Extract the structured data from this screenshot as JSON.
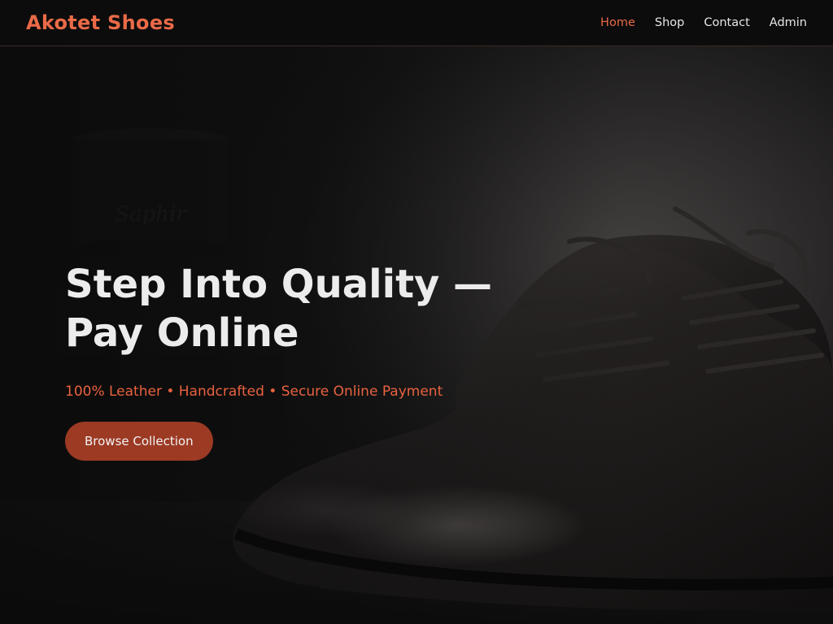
{
  "brand": {
    "name": "Akotet Shoes"
  },
  "nav": {
    "items": [
      {
        "label": "Home",
        "active": true
      },
      {
        "label": "Shop",
        "active": false
      },
      {
        "label": "Contact",
        "active": false
      },
      {
        "label": "Admin",
        "active": false
      }
    ]
  },
  "hero": {
    "title_line1": "Step Into Quality —",
    "title_line2": "Pay Online",
    "subtitle": "100% Leather • Handcrafted • Secure Online Payment",
    "cta_label": "Browse Collection",
    "image": {
      "subject": "black leather oxford shoes",
      "logo_text": "Saphir"
    }
  },
  "colors": {
    "accent": "#ea6a48",
    "cta_bg": "#9c3a24",
    "nav_bg": "#0c0c0c",
    "title_text": "#ececec"
  }
}
